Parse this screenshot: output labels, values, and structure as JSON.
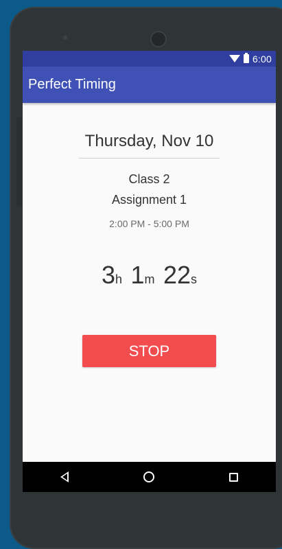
{
  "status_bar": {
    "time": "6:00",
    "icons": [
      "wifi-icon",
      "battery-icon"
    ]
  },
  "app_bar": {
    "title": "Perfect Timing"
  },
  "session": {
    "date": "Thursday, Nov 10",
    "class_name": "Class 2",
    "assignment": "Assignment 1",
    "time_range": "2:00 PM - 5:00 PM"
  },
  "timer": {
    "hours": "3",
    "hours_unit": "h",
    "minutes": "1",
    "minutes_unit": "m",
    "seconds": "22",
    "seconds_unit": "s"
  },
  "actions": {
    "stop_label": "STOP"
  },
  "nav_bar": {
    "icons": [
      "back-icon",
      "home-icon",
      "recents-icon"
    ]
  },
  "colors": {
    "primary": "#3f51b5",
    "primary_dark": "#303f9f",
    "stop_button": "#f24c4f",
    "background": "#fafafa"
  }
}
